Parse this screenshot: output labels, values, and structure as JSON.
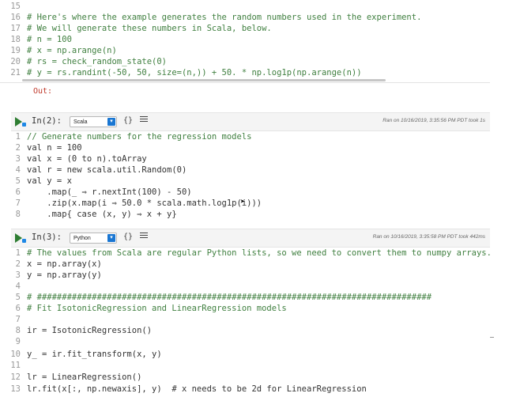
{
  "top_cell": {
    "lines": [
      {
        "n": "15",
        "text": ""
      },
      {
        "n": "16",
        "text": "# Here's where the example generates the random numbers used in the experiment."
      },
      {
        "n": "17",
        "text": "# We will generate these numbers in Scala, below."
      },
      {
        "n": "18",
        "text": "# n = 100"
      },
      {
        "n": "19",
        "text": "# x = np.arange(n)"
      },
      {
        "n": "20",
        "text": "# rs = check_random_state(0)"
      },
      {
        "n": "21",
        "text": "# y = rs.randint(-50, 50, size=(n,)) + 50. * np.log1p(np.arange(n))"
      }
    ],
    "out_label": "Out:"
  },
  "cell_2": {
    "in_label": "In(2):",
    "language": "Scala",
    "braces": "{}",
    "ran_on": "Ran on 10/16/2019, 3:35:56 PM PDT took 1s",
    "lines": [
      {
        "n": "1",
        "text": "// Generate numbers for the regression models"
      },
      {
        "n": "2",
        "text": "val n = 100"
      },
      {
        "n": "3",
        "text": "val x = (0 to n).toArray"
      },
      {
        "n": "4",
        "text": "val r = new scala.util.Random(0)"
      },
      {
        "n": "5",
        "text": "val y = x"
      },
      {
        "n": "6",
        "text": "    .map(_ ⇒ r.nextInt(100) - 50)"
      },
      {
        "n": "7",
        "text": "    .zip(x.map(i ⇒ 50.0 * scala.math.log1p(i)))"
      },
      {
        "n": "8",
        "text": "    .map{ case (x, y) ⇒ x + y}"
      }
    ]
  },
  "cell_3": {
    "in_label": "In(3):",
    "language": "Python",
    "braces": "{}",
    "ran_on": "Ran on 10/16/2019, 3:35:58 PM PDT took 442ms",
    "lines": [
      {
        "n": "1",
        "text": "# The values from Scala are regular Python lists, so we need to convert them to numpy arrays."
      },
      {
        "n": "2",
        "text": "x = np.array(x)"
      },
      {
        "n": "3",
        "text": "y = np.array(y)"
      },
      {
        "n": "4",
        "text": ""
      },
      {
        "n": "5",
        "text": "# ###############################################################################"
      },
      {
        "n": "6",
        "text": "# Fit IsotonicRegression and LinearRegression models"
      },
      {
        "n": "7",
        "text": ""
      },
      {
        "n": "8",
        "text": "ir = IsotonicRegression()"
      },
      {
        "n": "9",
        "text": ""
      },
      {
        "n": "10",
        "text": "y_ = ir.fit_transform(x, y)"
      },
      {
        "n": "11",
        "text": ""
      },
      {
        "n": "12",
        "text": "lr = LinearRegression()"
      },
      {
        "n": "13",
        "text": "lr.fit(x[:, np.newaxis], y)  # x needs to be 2d for LinearRegression"
      }
    ]
  },
  "icons": {
    "run": "run-icon",
    "menu": "hamburger-menu-icon",
    "caret": "dropdown-caret-icon",
    "cursor": "mouse-cursor-icon"
  },
  "colors": {
    "comment": "#3f7f3f",
    "keyword": "#000000",
    "number": "#3a8f5f",
    "out_label": "#c0392b",
    "run_icon": "#2e7d32",
    "select_caret": "#1976d2"
  }
}
